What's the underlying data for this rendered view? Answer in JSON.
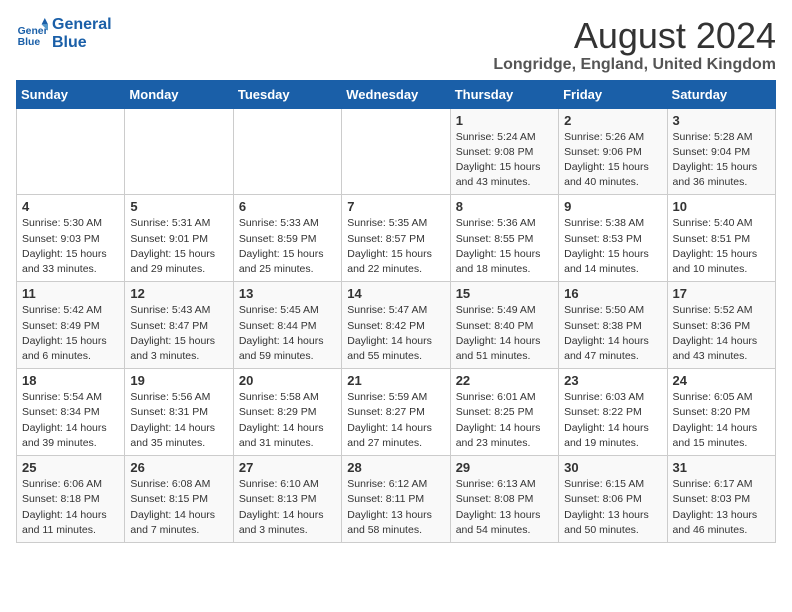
{
  "logo": {
    "line1": "General",
    "line2": "Blue"
  },
  "title": "August 2024",
  "subtitle": "Longridge, England, United Kingdom",
  "header": {
    "days": [
      "Sunday",
      "Monday",
      "Tuesday",
      "Wednesday",
      "Thursday",
      "Friday",
      "Saturday"
    ]
  },
  "weeks": [
    [
      {
        "day": "",
        "detail": ""
      },
      {
        "day": "",
        "detail": ""
      },
      {
        "day": "",
        "detail": ""
      },
      {
        "day": "",
        "detail": ""
      },
      {
        "day": "1",
        "detail": "Sunrise: 5:24 AM\nSunset: 9:08 PM\nDaylight: 15 hours\nand 43 minutes."
      },
      {
        "day": "2",
        "detail": "Sunrise: 5:26 AM\nSunset: 9:06 PM\nDaylight: 15 hours\nand 40 minutes."
      },
      {
        "day": "3",
        "detail": "Sunrise: 5:28 AM\nSunset: 9:04 PM\nDaylight: 15 hours\nand 36 minutes."
      }
    ],
    [
      {
        "day": "4",
        "detail": "Sunrise: 5:30 AM\nSunset: 9:03 PM\nDaylight: 15 hours\nand 33 minutes."
      },
      {
        "day": "5",
        "detail": "Sunrise: 5:31 AM\nSunset: 9:01 PM\nDaylight: 15 hours\nand 29 minutes."
      },
      {
        "day": "6",
        "detail": "Sunrise: 5:33 AM\nSunset: 8:59 PM\nDaylight: 15 hours\nand 25 minutes."
      },
      {
        "day": "7",
        "detail": "Sunrise: 5:35 AM\nSunset: 8:57 PM\nDaylight: 15 hours\nand 22 minutes."
      },
      {
        "day": "8",
        "detail": "Sunrise: 5:36 AM\nSunset: 8:55 PM\nDaylight: 15 hours\nand 18 minutes."
      },
      {
        "day": "9",
        "detail": "Sunrise: 5:38 AM\nSunset: 8:53 PM\nDaylight: 15 hours\nand 14 minutes."
      },
      {
        "day": "10",
        "detail": "Sunrise: 5:40 AM\nSunset: 8:51 PM\nDaylight: 15 hours\nand 10 minutes."
      }
    ],
    [
      {
        "day": "11",
        "detail": "Sunrise: 5:42 AM\nSunset: 8:49 PM\nDaylight: 15 hours\nand 6 minutes."
      },
      {
        "day": "12",
        "detail": "Sunrise: 5:43 AM\nSunset: 8:47 PM\nDaylight: 15 hours\nand 3 minutes."
      },
      {
        "day": "13",
        "detail": "Sunrise: 5:45 AM\nSunset: 8:44 PM\nDaylight: 14 hours\nand 59 minutes."
      },
      {
        "day": "14",
        "detail": "Sunrise: 5:47 AM\nSunset: 8:42 PM\nDaylight: 14 hours\nand 55 minutes."
      },
      {
        "day": "15",
        "detail": "Sunrise: 5:49 AM\nSunset: 8:40 PM\nDaylight: 14 hours\nand 51 minutes."
      },
      {
        "day": "16",
        "detail": "Sunrise: 5:50 AM\nSunset: 8:38 PM\nDaylight: 14 hours\nand 47 minutes."
      },
      {
        "day": "17",
        "detail": "Sunrise: 5:52 AM\nSunset: 8:36 PM\nDaylight: 14 hours\nand 43 minutes."
      }
    ],
    [
      {
        "day": "18",
        "detail": "Sunrise: 5:54 AM\nSunset: 8:34 PM\nDaylight: 14 hours\nand 39 minutes."
      },
      {
        "day": "19",
        "detail": "Sunrise: 5:56 AM\nSunset: 8:31 PM\nDaylight: 14 hours\nand 35 minutes."
      },
      {
        "day": "20",
        "detail": "Sunrise: 5:58 AM\nSunset: 8:29 PM\nDaylight: 14 hours\nand 31 minutes."
      },
      {
        "day": "21",
        "detail": "Sunrise: 5:59 AM\nSunset: 8:27 PM\nDaylight: 14 hours\nand 27 minutes."
      },
      {
        "day": "22",
        "detail": "Sunrise: 6:01 AM\nSunset: 8:25 PM\nDaylight: 14 hours\nand 23 minutes."
      },
      {
        "day": "23",
        "detail": "Sunrise: 6:03 AM\nSunset: 8:22 PM\nDaylight: 14 hours\nand 19 minutes."
      },
      {
        "day": "24",
        "detail": "Sunrise: 6:05 AM\nSunset: 8:20 PM\nDaylight: 14 hours\nand 15 minutes."
      }
    ],
    [
      {
        "day": "25",
        "detail": "Sunrise: 6:06 AM\nSunset: 8:18 PM\nDaylight: 14 hours\nand 11 minutes."
      },
      {
        "day": "26",
        "detail": "Sunrise: 6:08 AM\nSunset: 8:15 PM\nDaylight: 14 hours\nand 7 minutes."
      },
      {
        "day": "27",
        "detail": "Sunrise: 6:10 AM\nSunset: 8:13 PM\nDaylight: 14 hours\nand 3 minutes."
      },
      {
        "day": "28",
        "detail": "Sunrise: 6:12 AM\nSunset: 8:11 PM\nDaylight: 13 hours\nand 58 minutes."
      },
      {
        "day": "29",
        "detail": "Sunrise: 6:13 AM\nSunset: 8:08 PM\nDaylight: 13 hours\nand 54 minutes."
      },
      {
        "day": "30",
        "detail": "Sunrise: 6:15 AM\nSunset: 8:06 PM\nDaylight: 13 hours\nand 50 minutes."
      },
      {
        "day": "31",
        "detail": "Sunrise: 6:17 AM\nSunset: 8:03 PM\nDaylight: 13 hours\nand 46 minutes."
      }
    ]
  ]
}
